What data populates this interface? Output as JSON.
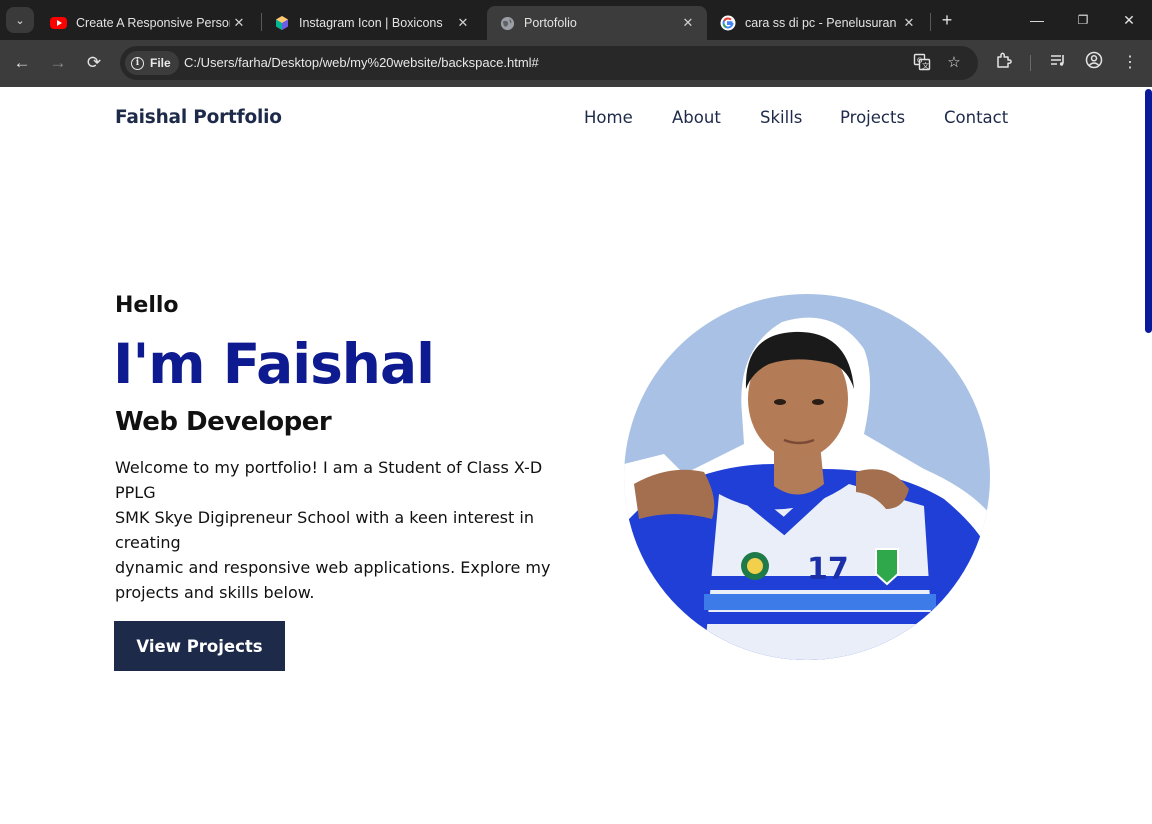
{
  "browser": {
    "tabs": [
      {
        "title": "Create A Responsive Persona",
        "favicon": "youtube-icon"
      },
      {
        "title": "Instagram Icon | Boxicons",
        "favicon": "boxicons-icon"
      },
      {
        "title": "Portofolio",
        "favicon": "globe-icon",
        "active": true
      },
      {
        "title": "cara ss di pc - Penelusuran G",
        "favicon": "google-icon"
      }
    ],
    "address": {
      "chip": "File",
      "url": "C:/Users/farha/Desktop/web/my%20website/backspace.html#"
    }
  },
  "site": {
    "brand": "Faishal Portfolio",
    "nav": [
      "Home",
      "About",
      "Skills",
      "Projects",
      "Contact"
    ]
  },
  "hero": {
    "greeting": "Hello",
    "name": "I'm Faishal",
    "role": "Web Developer",
    "description_lines": [
      "Welcome to my portfolio! I am a Student of Class X-D",
      "PPLG",
      "SMK Skye Digipreneur School with a keen interest in",
      "creating",
      "dynamic and responsive web applications. Explore my",
      "projects and skills below."
    ],
    "cta": "View Projects",
    "portrait": {
      "jersey_number": "17"
    }
  },
  "colors": {
    "name_accent": "#0e1a8f",
    "navy": "#1e2a4a",
    "portrait_bg": "#a8c1e4",
    "scrollbar": "#0b1a9a"
  }
}
